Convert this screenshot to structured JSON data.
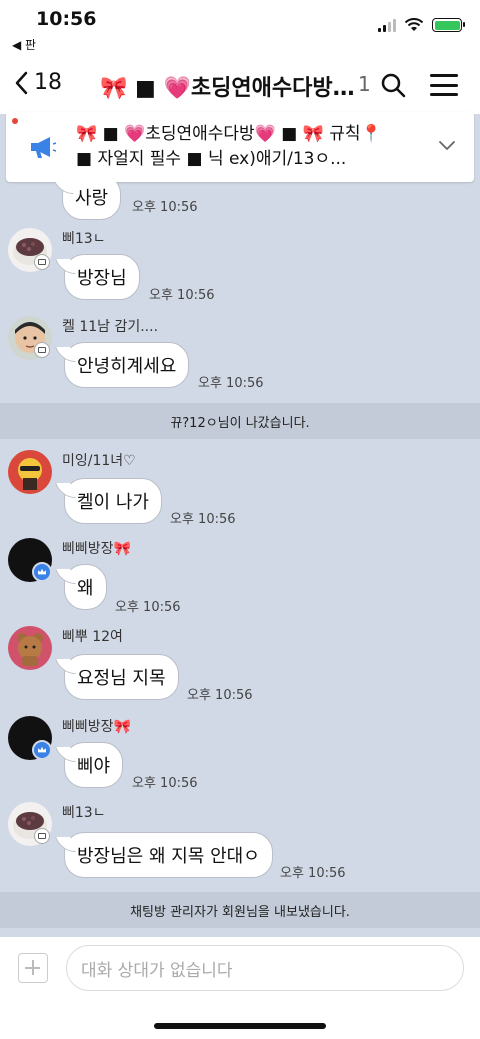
{
  "status": {
    "time": "10:56",
    "back_app": "◀ 판"
  },
  "nav": {
    "back_count": "18",
    "title": "🎀 ■ 💗초딩연애수다방…",
    "member_count": "1"
  },
  "notice": {
    "line1": "🎀 ■ 💗초딩연애수다방💗 ■ 🎀 규칙📍",
    "line2": "■ 자얼지 필수 ■ 닉 ex)애기/13ㅇ..."
  },
  "messages": [
    {
      "sender": "",
      "text": "사랑",
      "time": "오후 10:56"
    },
    {
      "sender": "삐13ㄴ",
      "text": "방장님",
      "time": "오후 10:56"
    },
    {
      "sender": "켈 11남 감기....",
      "text": "안녕히계세요",
      "time": "오후 10:56"
    },
    {
      "sender": "미잉/11녀♡",
      "text": "켈이 나가",
      "time": "오후 10:56"
    },
    {
      "sender": "삐삐방장🎀",
      "text": "왜",
      "time": "오후 10:56"
    },
    {
      "sender": "삐뿌 12여",
      "text": "요정님 지목",
      "time": "오후 10:56"
    },
    {
      "sender": "삐삐방장🎀",
      "text": "삐야",
      "time": "오후 10:56"
    },
    {
      "sender": "삐13ㄴ",
      "text": "방장님은 왜 지목 안대ㅇ",
      "time": "오후 10:56"
    }
  ],
  "system": {
    "left": "뀨?12ㅇ님이 나갔습니다.",
    "kicked": "채팅방 관리자가 회원님을 내보냈습니다."
  },
  "input": {
    "placeholder": "대화 상대가 없습니다"
  },
  "colors": {
    "background": "#d2d9e6",
    "system_bar": "#c3cbd8",
    "crown_badge": "#3b82e6",
    "notice_icon": "#3b82e6"
  }
}
